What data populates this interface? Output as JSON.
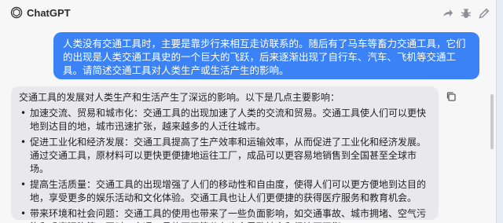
{
  "app": {
    "title": "ChatGPT"
  },
  "toolbar": {
    "icons": [
      "share-icon",
      "bug-icon",
      "new-chat-icon"
    ]
  },
  "messages": {
    "user": {
      "text": "人类没有交通工具时，主要是靠步行来相互走访联系的。随后有了马车等畜力交通工具，它们的出现是人类交通工具史的一个巨大的飞跃，后来逐渐出现了自行车、汽车、飞机等交通工具。请简述交通工具对人类生产或生活产生的影响。"
    },
    "assistant": {
      "intro": "交通工具的发展对人类生产和生活产生了深远的影响。以下是几点主要影响：",
      "points": [
        "加速交流、贸易和城市化：交通工具的出现加速了人类的交流和贸易。交通工具使人们可以更快地到达目的地，城市迅速扩张，越来越多的人迁往城市。",
        "促进工业化和经济发展：交通工具提高了生产效率和运输效率，从而促进了工业化和经济发展。通过交通工具，原材料可以更快更便捷地运往工厂，成品可以更容易地销售到全国甚至全球市场。",
        "提高生活质量：交通工具的出现增强了人们的移动性和自由度，使得人们可以更方便地到达目的地，享受更多的娱乐活动和文化体验。交通工具也让人们更便捷的获得医疗服务和教育机会。",
        "带来环境和社会问题：交通工具的使用也带来了一些负面影响，如交通事故、城市拥堵、空气污染和噪声污染等。同时，交通工具的不平等分布也会导致社会和经济不平衡。"
      ]
    }
  },
  "colors": {
    "user_bubble": "#3b82f6",
    "assistant_bubble": "#e9e9ec",
    "background": "#f7f7f8"
  }
}
